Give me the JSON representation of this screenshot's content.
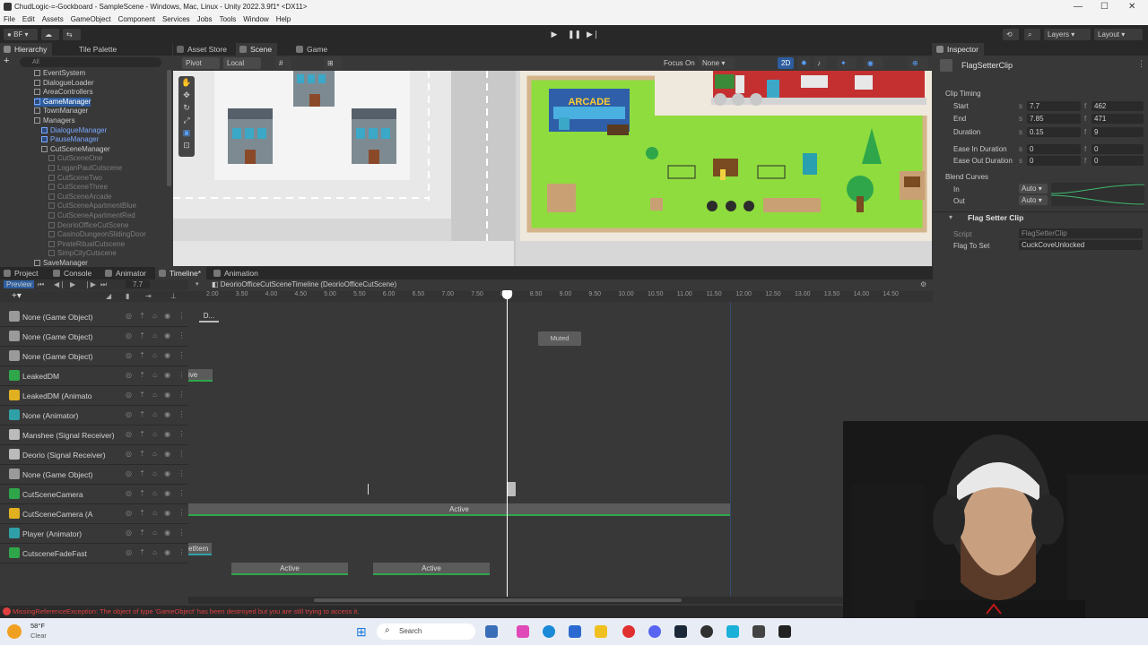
{
  "window": {
    "title": "ChudLogic-=-Gockboard - SampleScene - Windows, Mac, Linux - Unity 2022.3.9f1* <DX11>"
  },
  "menu": [
    "File",
    "Edit",
    "Assets",
    "GameObject",
    "Component",
    "Services",
    "Jobs",
    "Tools",
    "Window",
    "Help"
  ],
  "toolbar": {
    "account": "BF",
    "layers": "Layers",
    "layout": "Layout"
  },
  "hierarchy": {
    "tab": "Hierarchy",
    "tab2": "Tile Palette",
    "search_placeholder": "All",
    "items": [
      {
        "label": "EventSystem",
        "indent": 0,
        "style": "normal"
      },
      {
        "label": "DialogueLoader",
        "indent": 0,
        "style": "normal"
      },
      {
        "label": "AreaControllers",
        "indent": 0,
        "style": "normal"
      },
      {
        "label": "GameManager",
        "indent": 0,
        "style": "blue"
      },
      {
        "label": "TownManager",
        "indent": 0,
        "style": "normal"
      },
      {
        "label": "Managers",
        "indent": 0,
        "style": "normal"
      },
      {
        "label": "DialogueManager",
        "indent": 1,
        "style": "blue"
      },
      {
        "label": "PauseManager",
        "indent": 1,
        "style": "blue"
      },
      {
        "label": "CutSceneManager",
        "indent": 1,
        "style": "normal"
      },
      {
        "label": "CutSceneOne",
        "indent": 2,
        "style": "grey"
      },
      {
        "label": "LoganPaulCutscene",
        "indent": 2,
        "style": "grey"
      },
      {
        "label": "CutSceneTwo",
        "indent": 2,
        "style": "grey"
      },
      {
        "label": "CutSceneThree",
        "indent": 2,
        "style": "grey"
      },
      {
        "label": "CutSceneArcade",
        "indent": 2,
        "style": "grey"
      },
      {
        "label": "CutSceneApartmentBlue",
        "indent": 2,
        "style": "grey"
      },
      {
        "label": "CutSceneApartmentRed",
        "indent": 2,
        "style": "grey"
      },
      {
        "label": "DeorioOfficeCutScene",
        "indent": 2,
        "style": "grey"
      },
      {
        "label": "CasinoDungeonSlidingDoor",
        "indent": 2,
        "style": "grey"
      },
      {
        "label": "PirateRitualCutscene",
        "indent": 2,
        "style": "grey"
      },
      {
        "label": "SimpCityCutscene",
        "indent": 2,
        "style": "grey"
      },
      {
        "label": "SaveManager",
        "indent": 0,
        "style": "normal"
      }
    ]
  },
  "scene_tabs": {
    "asset_store": "Asset Store",
    "scene": "Scene",
    "game": "Game"
  },
  "scene_toolbar": {
    "pivot": "Pivot",
    "local": "Local",
    "focus_on": "Focus On",
    "none": "None",
    "mode_2d": "2D"
  },
  "scene_view": {
    "arcade_sign": "ARCADE"
  },
  "bottom_tabs": {
    "project": "Project",
    "console": "Console",
    "animator": "Animator",
    "timeline": "Timeline*",
    "animation": "Animation"
  },
  "timeline": {
    "preview": "Preview",
    "frame": "7.7",
    "asset": "DeorioOfficeCutSceneTimeline (DeorioOfficeCutScene)",
    "ruler": [
      "2.00",
      "3.50",
      "4.00",
      "4.50",
      "5.00",
      "5.50",
      "6.00",
      "6.50",
      "7.00",
      "7.50",
      "8.00",
      "8.50",
      "9.00",
      "9.50",
      "10.00",
      "10.50",
      "11.00",
      "11.50",
      "12.00",
      "12.50",
      "13.00",
      "13.50",
      "14.00",
      "14.50"
    ],
    "tracks": [
      {
        "label": "None (Game Object)",
        "color": "#9a9a9a",
        "clip_text": "D..."
      },
      {
        "label": "None (Game Object)",
        "color": "#9a9a9a",
        "clip_text": "Muted"
      },
      {
        "label": "None (Game Object)",
        "color": "#9a9a9a",
        "clip_text": ""
      },
      {
        "label": "LeakedDM",
        "color": "#2fa64a",
        "clip_text": "ive"
      },
      {
        "label": "LeakedDM (Animato",
        "color": "#e0b020",
        "clip_text": ""
      },
      {
        "label": "None (Animator)",
        "color": "#30a0a8",
        "clip_text": ""
      },
      {
        "label": "Manshee (Signal Receiver)",
        "color": "#bbbbbb",
        "clip_text": ""
      },
      {
        "label": "Deorio (Signal Receiver)",
        "color": "#bbbbbb",
        "clip_text": ""
      },
      {
        "label": "None (Game Object)",
        "color": "#9a9a9a",
        "clip_text": ""
      },
      {
        "label": "CutSceneCamera",
        "color": "#2fa64a",
        "clip_text": "Active"
      },
      {
        "label": "CutSceneCamera (A",
        "color": "#e0b020",
        "clip_text": ""
      },
      {
        "label": "Player (Animator)",
        "color": "#30a0a8",
        "clip_text": "etItem"
      },
      {
        "label": "CutsceneFadeFast",
        "color": "#2fa64a",
        "clip_text": "Active"
      }
    ],
    "extra_clip_text": "Active"
  },
  "inspector": {
    "tab": "Inspector",
    "title": "FlagSetterClip",
    "clip_timing": "Clip Timing",
    "start_label": "Start",
    "start_s": "7.7",
    "start_f": "462",
    "end_label": "End",
    "end_s": "7.85",
    "end_f": "471",
    "duration_label": "Duration",
    "duration_s": "0.15",
    "duration_f": "9",
    "ease_in_label": "Ease In Duration",
    "ease_in_s": "0",
    "ease_in_f": "0",
    "ease_out_label": "Ease Out Duration",
    "ease_out_s": "0",
    "ease_out_f": "0",
    "blend_curves": "Blend Curves",
    "in_label": "In",
    "in_val": "Auto",
    "out_label": "Out",
    "out_val": "Auto",
    "section": "Flag Setter Clip",
    "script_label": "Script",
    "script_val": "FlagSetterClip",
    "flag_label": "Flag To Set",
    "flag_val": "CuckCoveUnlocked",
    "s_prefix": "s",
    "f_prefix": "f"
  },
  "status": {
    "error": "MissingReferenceException: The object of type 'GameObject' has been destroyed but you are still trying to access it."
  },
  "taskbar": {
    "weather_temp": "58°F",
    "weather_desc": "Clear",
    "search": "Search"
  },
  "colors": {
    "accent_blue": "#2d5d9f",
    "track_green": "#2fa64a",
    "error_red": "#e04040",
    "playhead": "#ffffff"
  }
}
